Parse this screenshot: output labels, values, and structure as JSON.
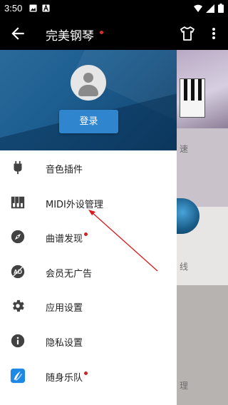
{
  "status_bar": {
    "time": "3:50"
  },
  "app_bar": {
    "title": "完美钢琴"
  },
  "drawer": {
    "login_label": "登录",
    "items": [
      {
        "label": "音色插件",
        "icon": "plugin-icon",
        "has_dot": false
      },
      {
        "label": "MIDI外设管理",
        "icon": "piano-keys-icon",
        "has_dot": false
      },
      {
        "label": "曲谱发现",
        "icon": "compass-icon",
        "has_dot": true
      },
      {
        "label": "会员无广告",
        "icon": "ad-off-icon",
        "has_dot": false
      },
      {
        "label": "应用设置",
        "icon": "gear-icon",
        "has_dot": false
      },
      {
        "label": "隐私设置",
        "icon": "info-icon",
        "has_dot": false
      },
      {
        "label": "随身乐队",
        "icon": "band-app-icon",
        "has_dot": true
      }
    ]
  },
  "background": {
    "fragments": [
      "速",
      "线",
      "理"
    ]
  },
  "colors": {
    "drawer_header": "#1d5e90",
    "login_button": "#2f86cf",
    "notification_dot": "#c62828",
    "annotation_arrow": "#d81b1b"
  }
}
